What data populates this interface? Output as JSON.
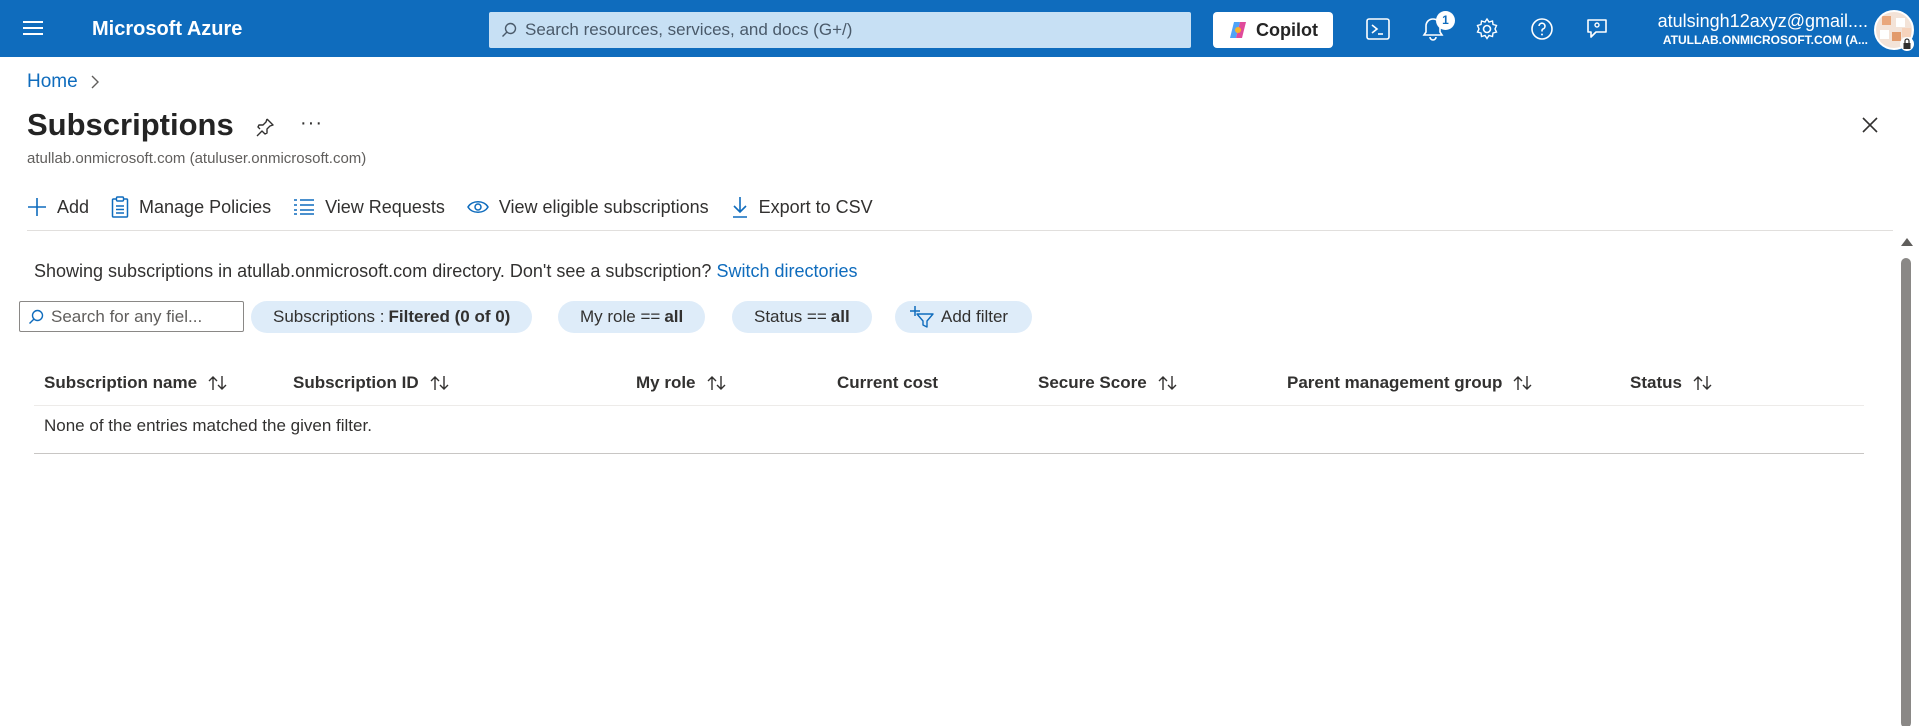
{
  "topbar": {
    "brand": "Microsoft Azure",
    "search_placeholder": "Search resources, services, and docs (G+/)",
    "copilot_label": "Copilot",
    "notification_count": "1",
    "account_email": "atulsingh12axyz@gmail....",
    "account_tenant": "ATULLAB.ONMICROSOFT.COM (A...",
    "brand_color": "#0f6cbd"
  },
  "breadcrumb": {
    "home": "Home"
  },
  "page": {
    "title": "Subscriptions",
    "subtitle": "atullab.onmicrosoft.com (atuluser.onmicrosoft.com)",
    "more": "···"
  },
  "toolbar": {
    "add": "Add",
    "manage_policies": "Manage Policies",
    "view_requests": "View Requests",
    "view_eligible": "View eligible subscriptions",
    "export_csv": "Export to CSV"
  },
  "info": {
    "text": "Showing subscriptions in atullab.onmicrosoft.com directory. Don't see a subscription?",
    "link": "Switch directories"
  },
  "filters": {
    "search_placeholder": "Search for any fiel...",
    "subscriptions_key": "Subscriptions :",
    "subscriptions_value": "Filtered (0 of 0)",
    "role_key": "My role ==",
    "role_value": "all",
    "status_key": "Status ==",
    "status_value": "all",
    "add_filter": "Add filter"
  },
  "table": {
    "columns": [
      "Subscription name",
      "Subscription ID",
      "My role",
      "Current cost",
      "Secure Score",
      "Parent management group",
      "Status"
    ],
    "empty_message": "None of the entries matched the given filter."
  }
}
